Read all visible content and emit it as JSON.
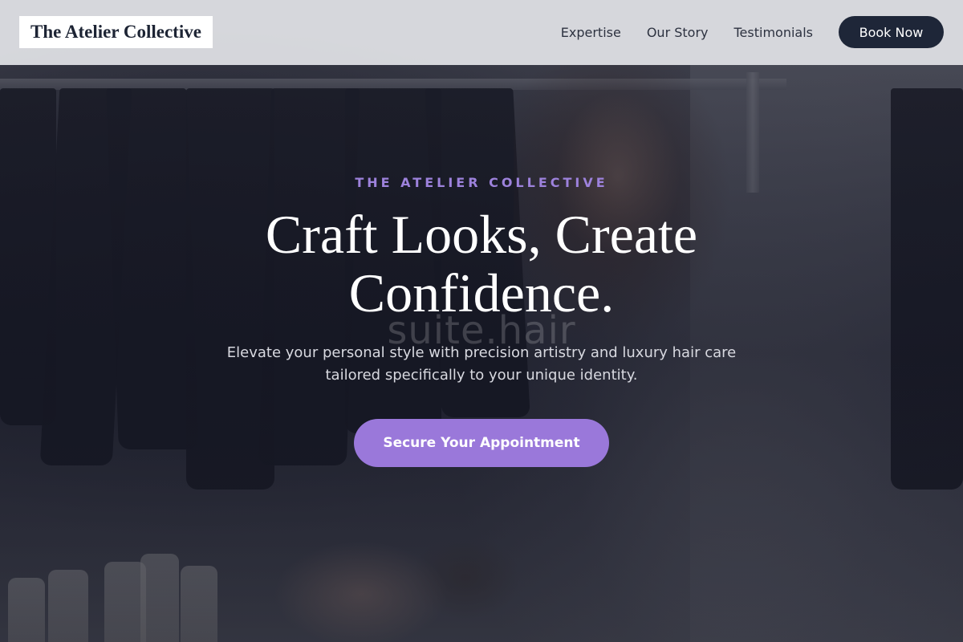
{
  "header": {
    "brand": "The Atelier Collective",
    "nav": [
      {
        "label": "Expertise"
      },
      {
        "label": "Our Story"
      },
      {
        "label": "Testimonials"
      }
    ],
    "book_button": "Book Now"
  },
  "hero": {
    "eyebrow": "THE ATELIER COLLECTIVE",
    "headline": "Craft Looks, Create Confidence.",
    "watermark": "suite.hair",
    "subtext": "Elevate your personal style with precision artistry and luxury hair care tailored specifically to your unique identity.",
    "cta": "Secure Your Appointment"
  },
  "colors": {
    "header_bg": "#e2e3e7",
    "primary_dark": "#1e2638",
    "accent_purple": "#9a78da",
    "eyebrow_purple": "#9d82dc"
  }
}
